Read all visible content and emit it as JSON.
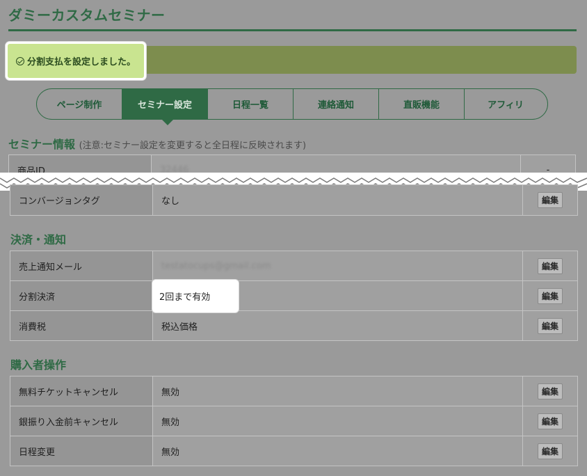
{
  "header": {
    "title": "ダミーカスタムセミナー"
  },
  "banner": {
    "message": "分割支払を設定しました。",
    "icon": "check-circle-icon"
  },
  "tabs": [
    {
      "label": "ページ制作",
      "active": false
    },
    {
      "label": "セミナー設定",
      "active": true
    },
    {
      "label": "日程一覧",
      "active": false
    },
    {
      "label": "連絡通知",
      "active": false
    },
    {
      "label": "直販機能",
      "active": false
    },
    {
      "label": "アフィリ",
      "active": false
    }
  ],
  "seminar_info": {
    "heading": "セミナー情報",
    "note": "(注意:セミナー設定を変更すると全日程に反映されます)",
    "rows": [
      {
        "label": "商品ID",
        "value": "32446",
        "action": "-"
      },
      {
        "label": "コンバージョンタグ",
        "value": "なし",
        "action": "編集"
      }
    ]
  },
  "payment": {
    "heading": "決済・通知",
    "rows": [
      {
        "label": "売上通知メール",
        "value": "testatocups@gmail.com",
        "action": "編集"
      },
      {
        "label": "分割決済",
        "value": "2回まで有効",
        "action": "編集"
      },
      {
        "label": "消費税",
        "value": "税込価格",
        "action": "編集"
      }
    ]
  },
  "buyer_ops": {
    "heading": "購入者操作",
    "rows": [
      {
        "label": "無料チケットキャンセル",
        "value": "無効",
        "action": "編集"
      },
      {
        "label": "銀振り入金前キャンセル",
        "value": "無効",
        "action": "編集"
      },
      {
        "label": "日程変更",
        "value": "無効",
        "action": "編集"
      }
    ]
  },
  "colors": {
    "brand": "#2f6a45",
    "banner": "#c9e490",
    "background": "#9a9a9a"
  }
}
